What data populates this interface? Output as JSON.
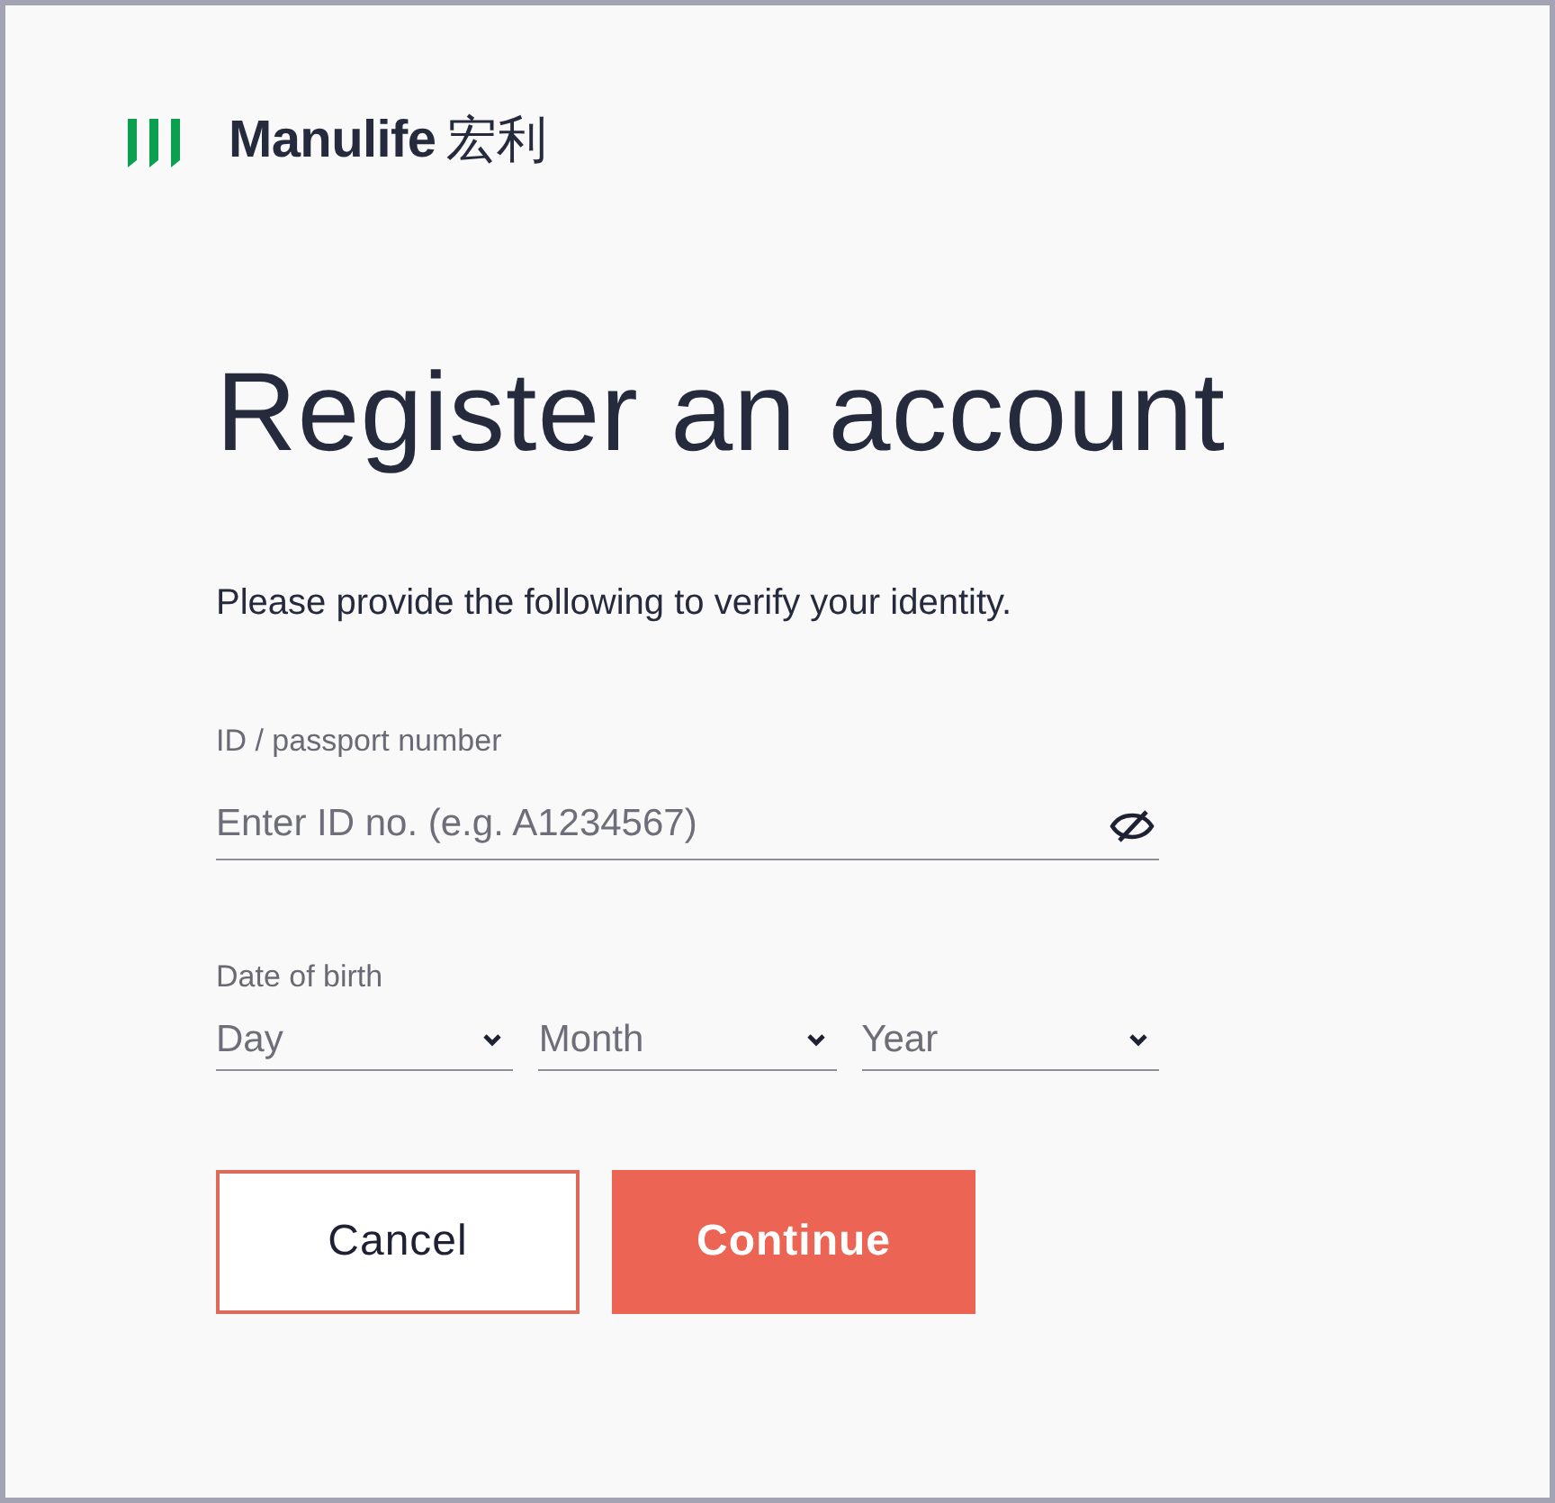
{
  "logo": {
    "brand": "Manulife",
    "brand_cjk": "宏利"
  },
  "title": "Register an account",
  "intro": "Please provide the following to verify your identity.",
  "id_field": {
    "label": "ID / passport number",
    "placeholder": "Enter ID no. (e.g. A1234567)"
  },
  "dob": {
    "label": "Date of birth",
    "selects": [
      {
        "placeholder": "Day"
      },
      {
        "placeholder": "Month"
      },
      {
        "placeholder": "Year"
      }
    ]
  },
  "buttons": [
    {
      "label": "Cancel",
      "kind": "secondary"
    },
    {
      "label": "Continue",
      "kind": "primary"
    }
  ]
}
